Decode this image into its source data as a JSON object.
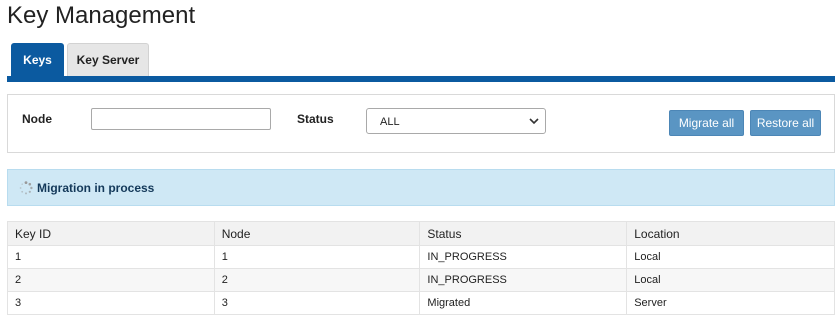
{
  "page": {
    "title": "Key Management"
  },
  "tabs": [
    {
      "label": "Keys",
      "active": true
    },
    {
      "label": "Key Server",
      "active": false
    }
  ],
  "filters": {
    "node_label": "Node",
    "node_value": "",
    "status_label": "Status",
    "status_selected": "ALL"
  },
  "buttons": {
    "migrate_all": "Migrate all",
    "restore_all": "Restore all"
  },
  "banner": {
    "text": "Migration in process",
    "icon": "spinner-icon"
  },
  "table": {
    "headers": [
      "Key ID",
      "Node",
      "Status",
      "Location"
    ],
    "rows": [
      [
        "1",
        "1",
        "IN_PROGRESS",
        "Local"
      ],
      [
        "2",
        "2",
        "IN_PROGRESS",
        "Local"
      ],
      [
        "3",
        "3",
        "Migrated",
        "Server"
      ]
    ]
  },
  "colors": {
    "accent": "#0b5aa0",
    "button": "#5a95c3",
    "banner_bg": "#cfe8f5",
    "banner_text": "#14395a"
  }
}
